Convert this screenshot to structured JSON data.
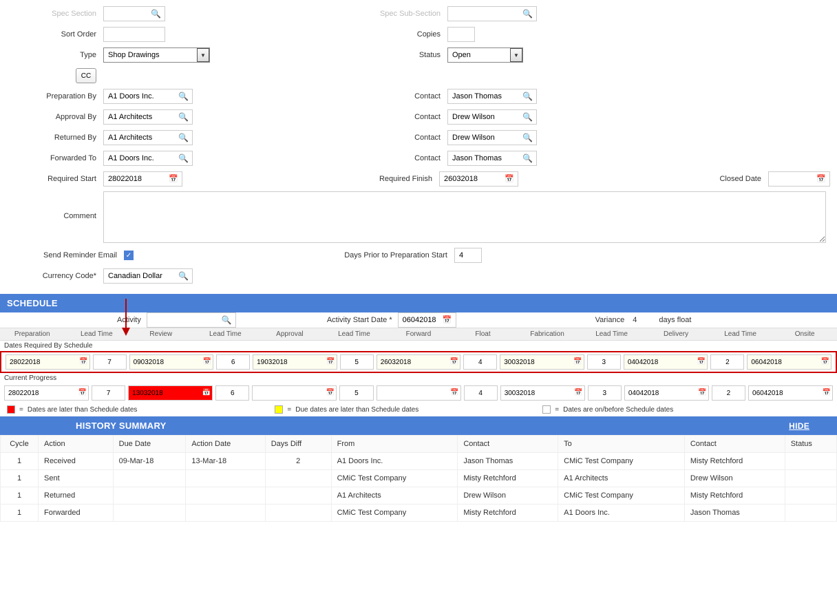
{
  "labels": {
    "specSection": "Spec Section",
    "specSubSection": "Spec Sub-Section",
    "sortOrder": "Sort Order",
    "copies": "Copies",
    "type": "Type",
    "status": "Status",
    "cc": "CC",
    "prepBy": "Preparation By",
    "apprBy": "Approval By",
    "retBy": "Returned By",
    "fwdTo": "Forwarded To",
    "contact": "Contact",
    "reqStart": "Required Start",
    "reqFinish": "Required Finish",
    "closedDate": "Closed Date",
    "comment": "Comment",
    "sendReminder": "Send Reminder Email",
    "daysPrior": "Days Prior to Preparation Start",
    "currency": "Currency Code*",
    "activity": "Activity",
    "activityStart": "Activity Start Date *",
    "variance": "Variance",
    "daysFloat": "days float",
    "datesReq": "Dates Required By Schedule",
    "curProg": "Current Progress"
  },
  "values": {
    "type": "Shop Drawings",
    "status": "Open",
    "prepBy": "A1 Doors Inc.",
    "prepContact": "Jason Thomas",
    "apprBy": "A1 Architects",
    "apprContact": "Drew Wilson",
    "retBy": "A1 Architects",
    "retContact": "Drew Wilson",
    "fwdTo": "A1 Doors Inc.",
    "fwdContact": "Jason Thomas",
    "reqStart": "28022018",
    "reqFinish": "26032018",
    "closedDate": "",
    "daysPrior": "4",
    "currency": "Canadian Dollar",
    "activity": "",
    "activityStart": "06042018",
    "variance": "4"
  },
  "sections": {
    "schedule": "SCHEDULE",
    "history": "HISTORY SUMMARY",
    "hide": "HIDE"
  },
  "schedHeaders": [
    "Preparation",
    "Lead Time",
    "Review",
    "Lead Time",
    "Approval",
    "Lead Time",
    "Forward",
    "Float",
    "Fabrication",
    "Lead Time",
    "Delivery",
    "Lead Time",
    "Onsite"
  ],
  "schedRequired": {
    "preparation": "28022018",
    "lt1": "7",
    "review": "09032018",
    "lt2": "6",
    "approval": "19032018",
    "lt3": "5",
    "forward": "26032018",
    "float": "4",
    "fabrication": "30032018",
    "lt4": "3",
    "delivery": "04042018",
    "lt5": "2",
    "onsite": "06042018"
  },
  "schedProgress": {
    "preparation": "28022018",
    "lt1": "7",
    "review": "13032018",
    "lt2": "6",
    "approval": "",
    "lt3": "5",
    "forward": "",
    "float": "4",
    "fabrication": "30032018",
    "lt4": "3",
    "delivery": "04042018",
    "lt5": "2",
    "onsite": "06042018"
  },
  "legend": {
    "red": "Dates are later than Schedule dates",
    "yellow": "Due dates are later than Schedule dates",
    "white": "Dates are on/before Schedule dates"
  },
  "histHeaders": {
    "cycle": "Cycle",
    "action": "Action",
    "due": "Due Date",
    "actDate": "Action Date",
    "diff": "Days Diff",
    "from": "From",
    "contact1": "Contact",
    "to": "To",
    "contact2": "Contact",
    "status": "Status"
  },
  "histRows": [
    {
      "cycle": "1",
      "action": "Received",
      "due": "09-Mar-18",
      "actDate": "13-Mar-18",
      "diff": "2",
      "from": "A1 Doors Inc.",
      "c1": "Jason Thomas",
      "to": "CMiC Test Company",
      "c2": "Misty Retchford",
      "status": ""
    },
    {
      "cycle": "1",
      "action": "Sent",
      "due": "",
      "actDate": "",
      "diff": "",
      "from": "CMiC Test Company",
      "c1": "Misty Retchford",
      "to": "A1 Architects",
      "c2": "Drew Wilson",
      "status": ""
    },
    {
      "cycle": "1",
      "action": "Returned",
      "due": "",
      "actDate": "",
      "diff": "",
      "from": "A1 Architects",
      "c1": "Drew Wilson",
      "to": "CMiC Test Company",
      "c2": "Misty Retchford",
      "status": ""
    },
    {
      "cycle": "1",
      "action": "Forwarded",
      "due": "",
      "actDate": "",
      "diff": "",
      "from": "CMiC Test Company",
      "c1": "Misty Retchford",
      "to": "A1 Doors Inc.",
      "c2": "Jason Thomas",
      "status": ""
    }
  ]
}
